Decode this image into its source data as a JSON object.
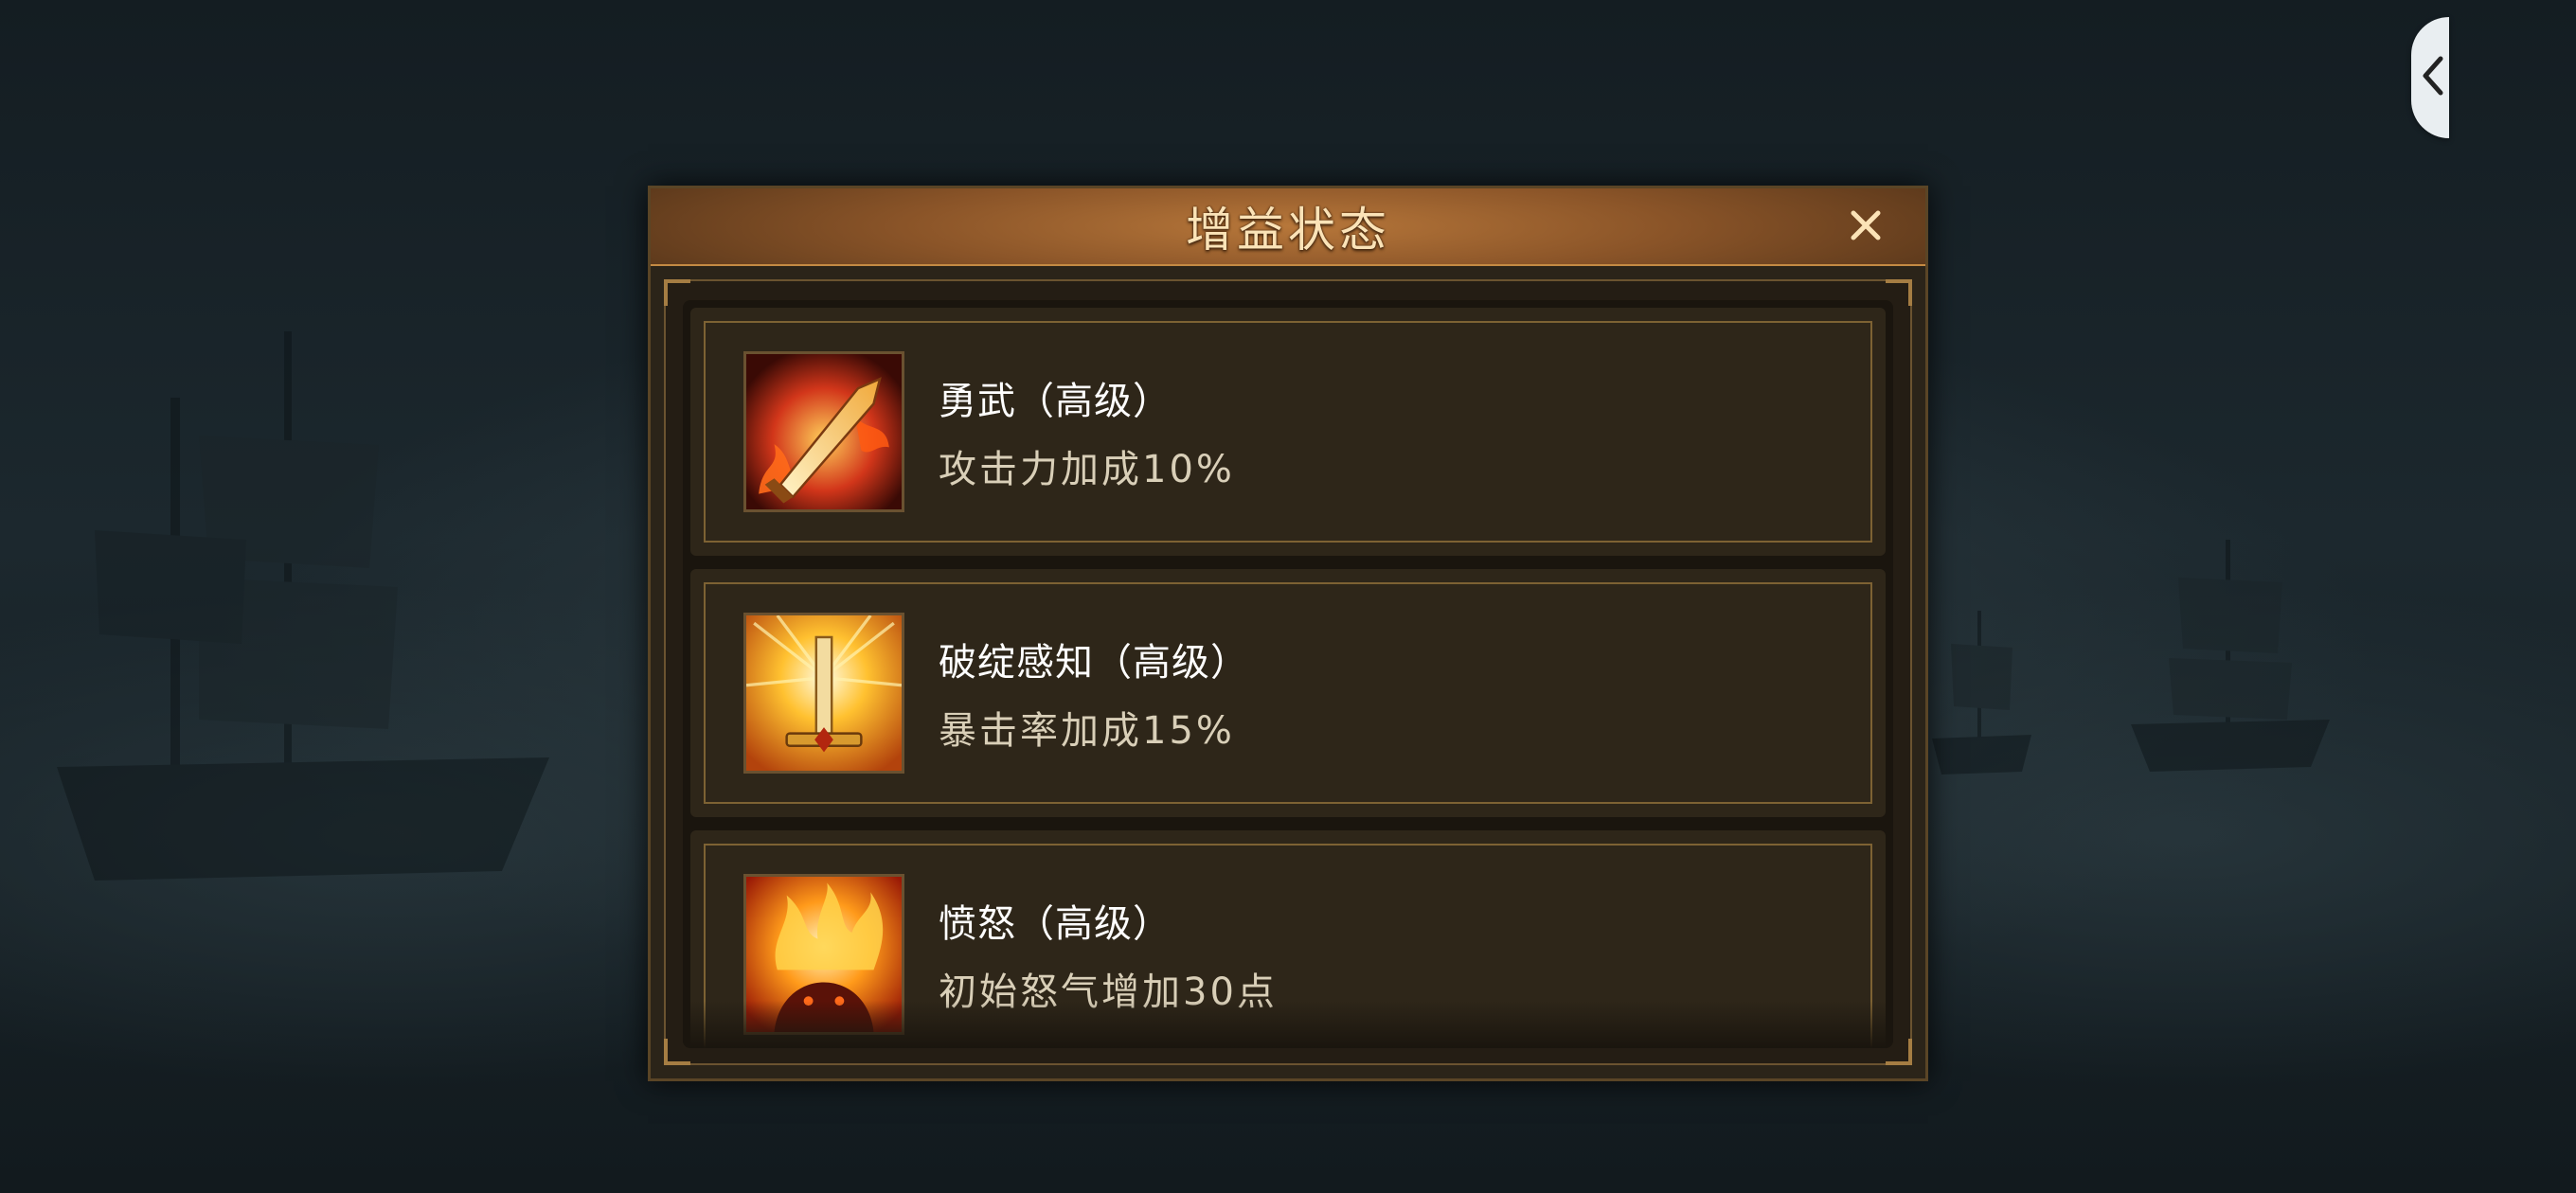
{
  "dialog": {
    "title": "增益状态",
    "close_label": "X"
  },
  "buffs": [
    {
      "name": "勇武（高级）",
      "description": "攻击力加成10%",
      "icon": "flaming-sword-icon"
    },
    {
      "name": "破绽感知（高级）",
      "description": "暴击率加成15%",
      "icon": "radiant-sword-icon"
    },
    {
      "name": "愤怒（高级）",
      "description": "初始怒气增加30点",
      "icon": "rage-fire-icon"
    }
  ],
  "side_button": {
    "icon": "chevron-left-icon"
  },
  "colors": {
    "header": "#8a5428",
    "title_text": "#fbe3b7",
    "card_border": "#7d6233",
    "desc_text": "#d9cfb8"
  }
}
